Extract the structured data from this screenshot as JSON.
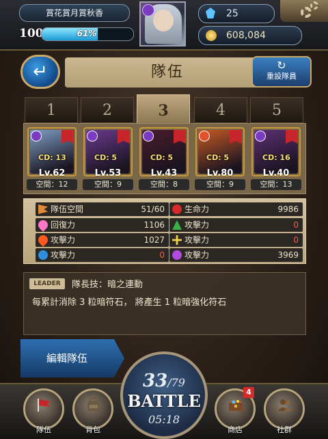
{
  "player": {
    "name": "賞花賞月賞秋香",
    "level": "100",
    "exp_percent_label": "61%",
    "exp_fraction": 0.61,
    "gems": "25",
    "coins": "608,084"
  },
  "page": {
    "title": "隊伍",
    "reset_label": "重設隊員"
  },
  "tabs": [
    {
      "label": "1",
      "active": false
    },
    {
      "label": "2",
      "active": false
    },
    {
      "label": "3",
      "active": true
    },
    {
      "label": "4",
      "active": false
    },
    {
      "label": "5",
      "active": false
    }
  ],
  "members": [
    {
      "cd": "CD: 13",
      "level": "Lv.62",
      "space": "空間：12",
      "attribute": "dark",
      "art_color": "#7ea0c6"
    },
    {
      "cd": "CD: 5",
      "level": "Lv.53",
      "space": "空間：9",
      "attribute": "dark",
      "art_color": "#6a3a8e"
    },
    {
      "cd": "CD: 5",
      "level": "Lv.43",
      "space": "空間：8",
      "attribute": "dark",
      "art_color": "#4a1c2c"
    },
    {
      "cd": "CD: 5",
      "level": "Lv.80",
      "space": "空間：9",
      "attribute": "fire",
      "art_color": "#c65a24"
    },
    {
      "cd": "CD: 16",
      "level": "Lv.40",
      "space": "空間：13",
      "attribute": "dark",
      "art_color": "#5e2f74"
    }
  ],
  "stats": {
    "team_space": {
      "label": "隊伍空間",
      "value": "51/60",
      "icon": "flag-icon"
    },
    "hp": {
      "label": "生命力",
      "value": "9986",
      "icon": "heart-red-icon"
    },
    "recovery": {
      "label": "回復力",
      "value": "1106",
      "icon": "heart-pink-icon"
    },
    "atk_wood": {
      "label": "攻擊力",
      "value": "0",
      "icon": "wood-icon"
    },
    "atk_fire": {
      "label": "攻擊力",
      "value": "1027",
      "icon": "fire-icon"
    },
    "atk_light": {
      "label": "攻擊力",
      "value": "0",
      "icon": "light-icon"
    },
    "atk_water": {
      "label": "攻擊力",
      "value": "0",
      "icon": "water-icon"
    },
    "atk_dark": {
      "label": "攻擊力",
      "value": "3969",
      "icon": "dark-icon"
    }
  },
  "leader": {
    "tag": "LEADER",
    "title": "隊長技：暗之連動",
    "description": "每累計消除 3 粒暗符石， 將產生 1 粒暗強化符石"
  },
  "edit_label": "編輯隊伍",
  "battle": {
    "stamina": "33",
    "stamina_max": "/79",
    "label": "BATTLE",
    "timer": "05:18"
  },
  "nav": {
    "team": "隊伍",
    "bag": "背包",
    "shop": "商店",
    "social": "社群",
    "shop_badge": "4"
  },
  "colors": {
    "accent_blue": "#1c9ad2",
    "gold": "#c89a3a",
    "dark_attr": "#7a3bc2",
    "fire_attr": "#e2522a"
  }
}
